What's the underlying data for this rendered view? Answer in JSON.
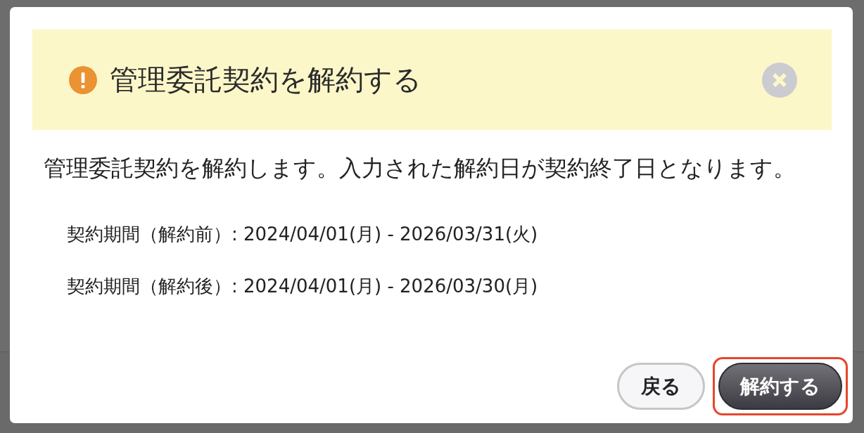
{
  "dialog": {
    "title": "管理委託契約を解約する",
    "message": "管理委託契約を解約します。入力された解約日が契約終了日となります。",
    "details": [
      "契約期間（解約前）: 2024/04/01(月) - 2026/03/31(火)",
      "契約期間（解約後）: 2024/04/01(月) - 2026/03/30(月)"
    ],
    "buttons": [
      {
        "label": "戻る",
        "kind": "secondary",
        "focused": false
      },
      {
        "label": "解約する",
        "kind": "primary",
        "focused": true
      }
    ]
  }
}
